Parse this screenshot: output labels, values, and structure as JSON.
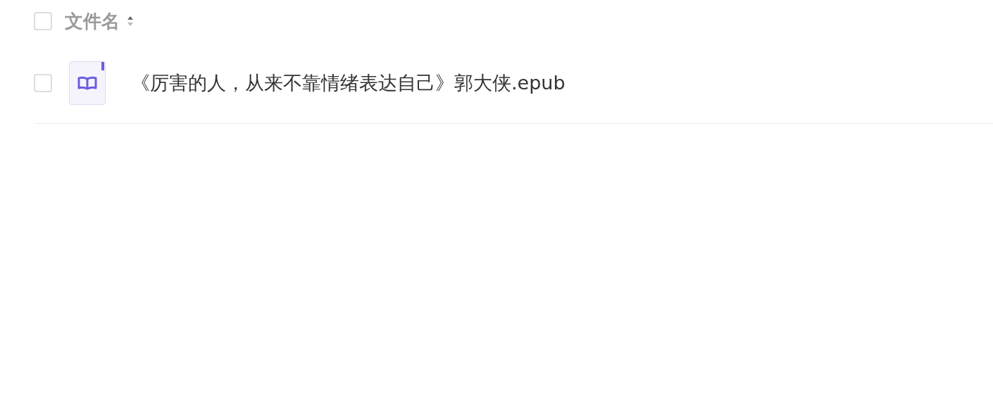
{
  "header": {
    "checked": false,
    "column": "文件名"
  },
  "rows": [
    {
      "checked": false,
      "name": "《厉害的人，从来不靠情绪表达自己》郭大侠.epub"
    }
  ]
}
